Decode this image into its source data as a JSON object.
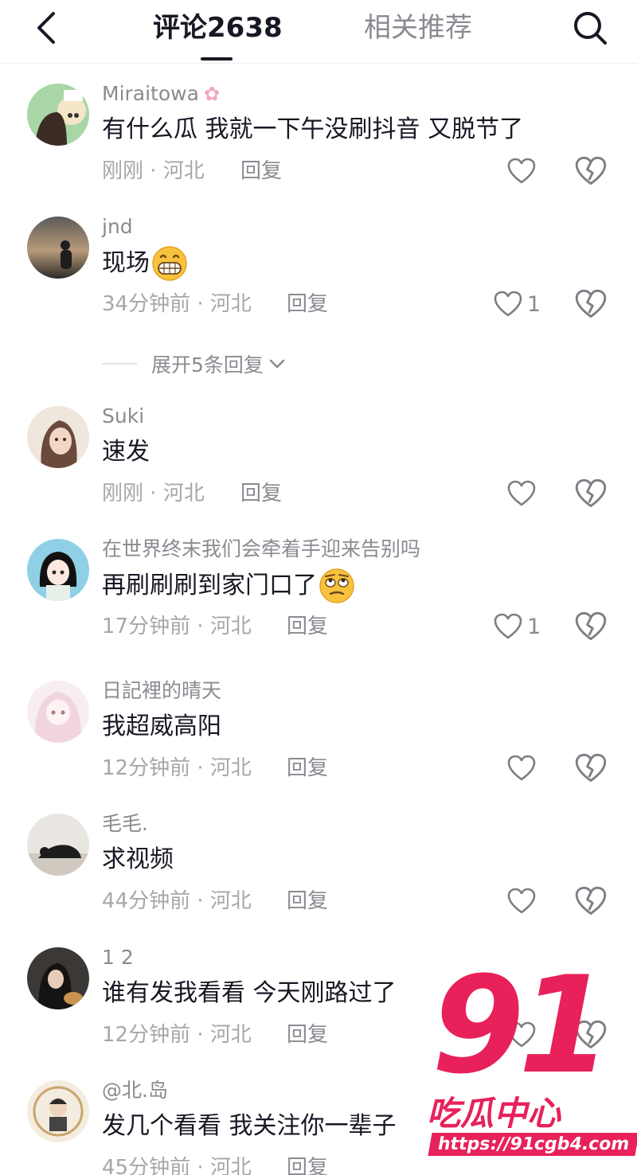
{
  "header": {
    "tab_comments": "评论2638",
    "tab_related": "相关推荐"
  },
  "comments": [
    {
      "username": "Miraitowa",
      "text": "有什么瓜   我就一下午没刷抖音  又脱节了",
      "time": "刚刚",
      "location": "河北",
      "reply": "回复",
      "likes": ""
    },
    {
      "username": "jnd",
      "text": "现场",
      "time": "34分钟前",
      "location": "河北",
      "reply": "回复",
      "likes": "1",
      "emoji": "grin"
    },
    {
      "username": "Suki",
      "text": "速发",
      "time": "刚刚",
      "location": "河北",
      "reply": "回复",
      "likes": ""
    },
    {
      "username": "在世界终末我们会牵着手迎来告别吗",
      "text": "再刷刷刷到家门口了",
      "time": "17分钟前",
      "location": "河北",
      "reply": "回复",
      "likes": "1",
      "emoji": "eyeroll"
    },
    {
      "username": "日記裡的晴天",
      "text": "我超威高阳",
      "time": "12分钟前",
      "location": "河北",
      "reply": "回复",
      "likes": ""
    },
    {
      "username": "毛毛.",
      "text": "求视频",
      "time": "44分钟前",
      "location": "河北",
      "reply": "回复",
      "likes": ""
    },
    {
      "username": "1 2",
      "text": "谁有发我看看 今天刚路过了",
      "time": "12分钟前",
      "location": "河北",
      "reply": "回复",
      "likes": ""
    },
    {
      "username": "@北.岛",
      "text": "发几个看看   我关注你一辈子",
      "time": "45分钟前",
      "location": "河北",
      "reply": "回复",
      "likes": ""
    }
  ],
  "expand_replies": "展开5条回复",
  "meta_separator": " · ",
  "watermark": {
    "number": "91",
    "subtitle": "吃瓜中心",
    "url": "https://91cgb4.com"
  },
  "colors": {
    "text_primary": "#161823",
    "text_secondary": "#8a8b91",
    "watermark": "#e8215a"
  }
}
